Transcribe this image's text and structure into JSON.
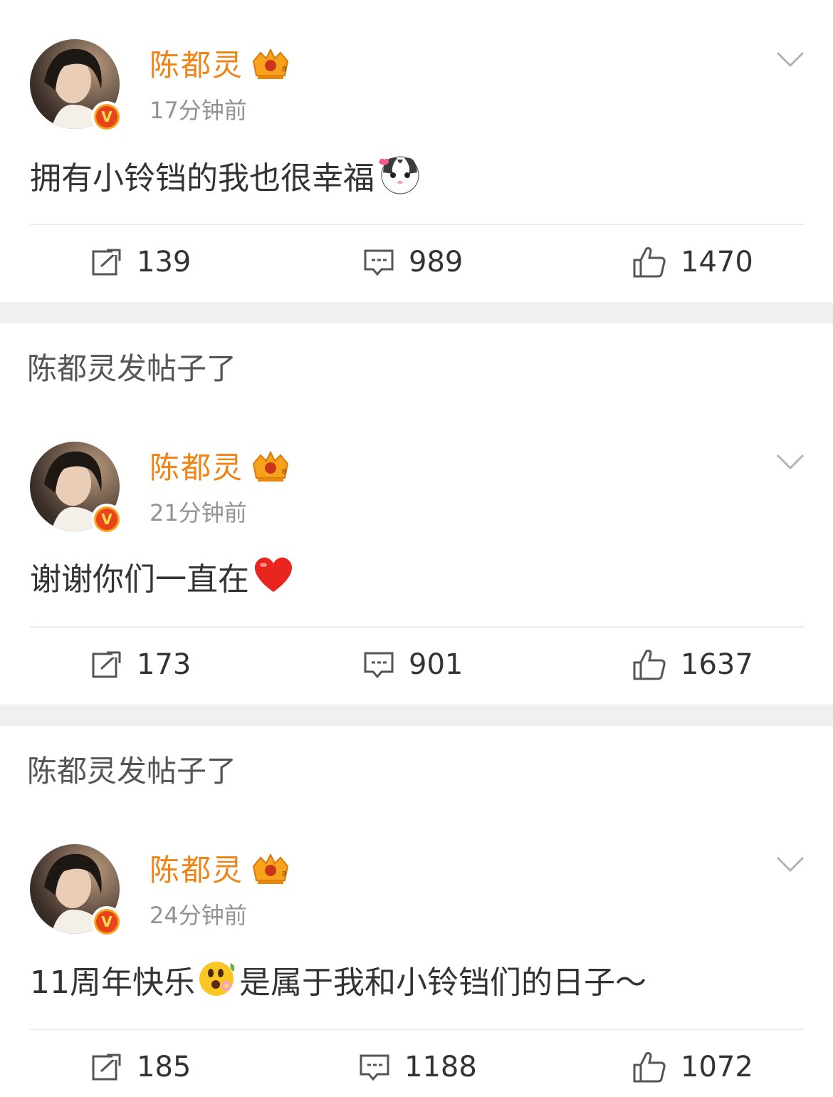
{
  "feed": {
    "posts": [
      {
        "username": "陈都灵",
        "time": "17分钟前",
        "text": "拥有小铃铛的我也很幸福",
        "emoji": "cat-emoji",
        "reposts": "139",
        "comments": "989",
        "likes": "1470"
      },
      {
        "username": "陈都灵",
        "time": "21分钟前",
        "text": "谢谢你们一直在",
        "emoji": "heart-emoji",
        "reposts": "173",
        "comments": "901",
        "likes": "1637"
      },
      {
        "username": "陈都灵",
        "time": "24分钟前",
        "text_before": "11周年快乐",
        "emoji": "flower-face-emoji",
        "text_after": "是属于我和小铃铛们的日子～",
        "reposts": "185",
        "comments": "1188",
        "likes": "1072"
      }
    ],
    "notices": [
      "陈都灵发帖子了",
      "陈都灵发帖子了"
    ]
  },
  "colors": {
    "username": "#f18215",
    "timestamp": "#939393",
    "separator": "#f0f0f0"
  }
}
